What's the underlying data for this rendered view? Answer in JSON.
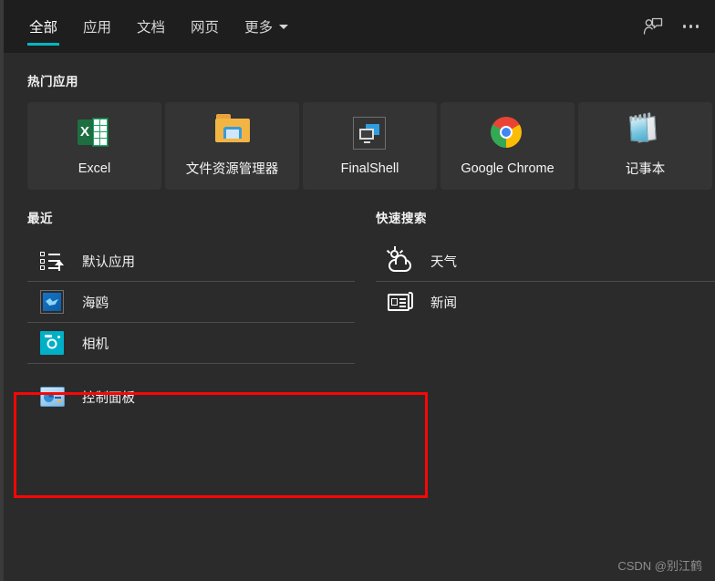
{
  "window": {
    "background_color": "#2b2b2b",
    "topbar_color": "#1e1e1e",
    "accent_color": "#00b7c3",
    "annotation_color": "#fb0505"
  },
  "topbar": {
    "tabs": [
      {
        "label": "全部",
        "active": true
      },
      {
        "label": "应用",
        "active": false
      },
      {
        "label": "文档",
        "active": false
      },
      {
        "label": "网页",
        "active": false
      },
      {
        "label": "更多",
        "active": false,
        "has_caret": true
      }
    ],
    "feedback_icon": "person-feedback-icon",
    "more_icon": "more-options-icon"
  },
  "popular_apps": {
    "heading": "热门应用",
    "tiles": [
      {
        "label": "Excel",
        "icon": "excel-icon"
      },
      {
        "label": "文件资源管理器",
        "icon": "folder-icon"
      },
      {
        "label": "FinalShell",
        "icon": "finalshell-icon"
      },
      {
        "label": "Google Chrome",
        "icon": "chrome-icon"
      },
      {
        "label": "记事本",
        "icon": "notepad-icon"
      }
    ]
  },
  "recent": {
    "heading": "最近",
    "items": [
      {
        "label": "默认应用",
        "icon": "default-apps-icon"
      },
      {
        "label": "海鸥",
        "icon": "seagull-app-icon"
      },
      {
        "label": "相机",
        "icon": "camera-icon"
      },
      {
        "label": "控制面板",
        "icon": "control-panel-icon",
        "highlighted": true
      }
    ]
  },
  "quick_search": {
    "heading": "快速搜索",
    "items": [
      {
        "label": "天气",
        "icon": "weather-icon"
      },
      {
        "label": "新闻",
        "icon": "news-icon"
      }
    ]
  },
  "watermark": {
    "text": "CSDN @别江鹤"
  }
}
